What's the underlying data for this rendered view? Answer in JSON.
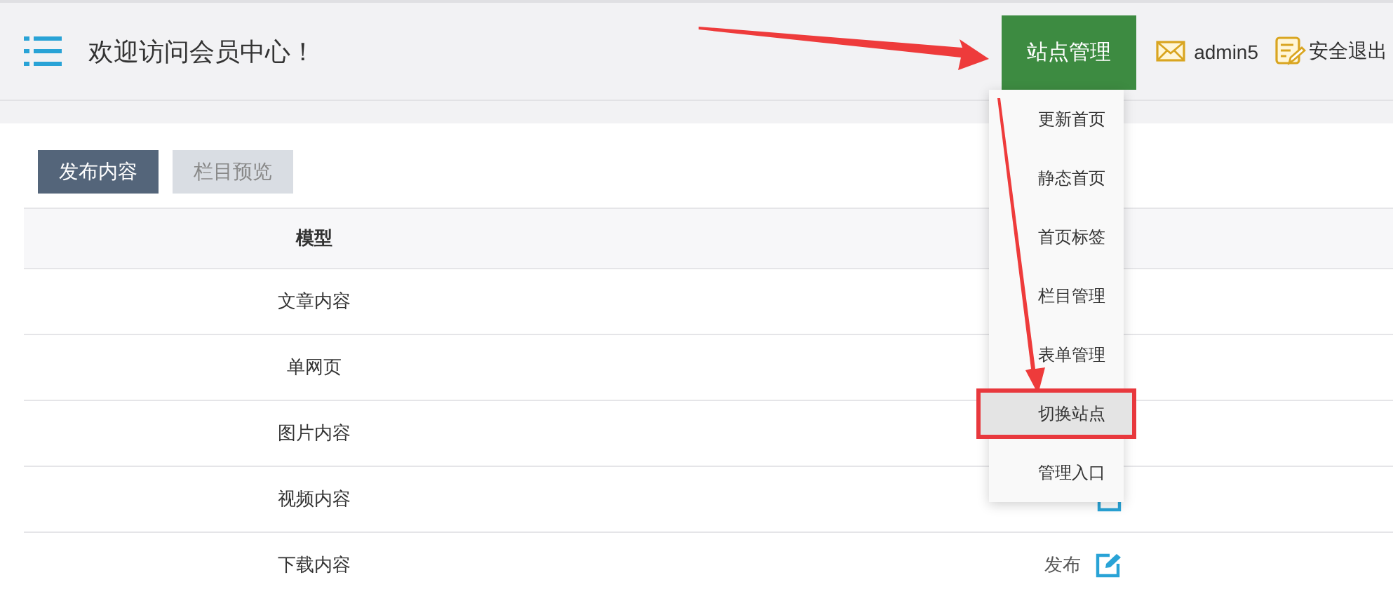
{
  "header": {
    "title": "欢迎访问会员中心！",
    "site_button": "站点管理",
    "user": "admin5",
    "logout": "安全退出"
  },
  "site_menu": [
    {
      "label": "更新首页",
      "selected": false,
      "highlighted": false
    },
    {
      "label": "静态首页",
      "selected": false,
      "highlighted": false
    },
    {
      "label": "首页标签",
      "selected": false,
      "highlighted": false
    },
    {
      "label": "栏目管理",
      "selected": false,
      "highlighted": false
    },
    {
      "label": "表单管理",
      "selected": false,
      "highlighted": false
    },
    {
      "label": "切换站点",
      "selected": true,
      "highlighted": true
    },
    {
      "label": "管理入口",
      "selected": false,
      "highlighted": false
    }
  ],
  "tabs": [
    {
      "label": "发布内容",
      "selected": true
    },
    {
      "label": "栏目预览",
      "selected": false
    }
  ],
  "table": {
    "columns": [
      "模型"
    ],
    "rows": [
      {
        "name": "文章内容"
      },
      {
        "name": "单网页"
      },
      {
        "name": "图片内容"
      },
      {
        "name": "视频内容",
        "edit": true
      },
      {
        "name": "下载内容",
        "action": "发布",
        "edit": true
      }
    ]
  }
}
